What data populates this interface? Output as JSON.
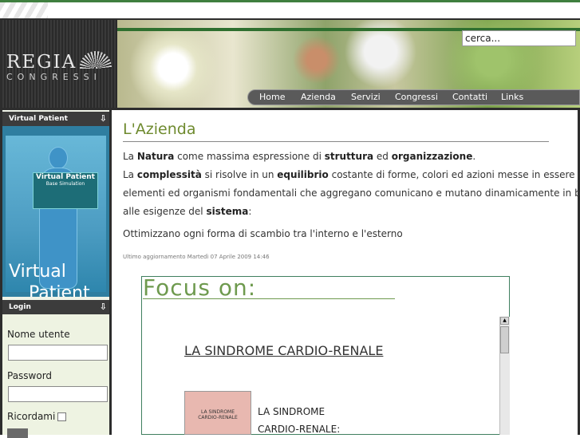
{
  "brand": {
    "name": "REGIA",
    "subtitle": "CONGRESSI"
  },
  "search": {
    "value": "cerca..."
  },
  "nav": {
    "items": [
      "Home",
      "Azienda",
      "Servizi",
      "Congressi",
      "Contatti",
      "Links"
    ]
  },
  "sidebar": {
    "virtual_patient": {
      "header": "Virtual Patient",
      "card_title": "Virtual Patient",
      "card_subtitle": "Base Simulation",
      "line1": "Virtual",
      "line2": "Patient"
    },
    "login": {
      "header": "Login",
      "username_label": "Nome utente",
      "password_label": "Password",
      "remember_label": "Ricordami"
    }
  },
  "main": {
    "title": "L'Azienda",
    "updated": "Ultimo aggiornamento Martedì 07 Aprile 2009 14:46",
    "focus": {
      "title": "Focus on:",
      "link": "LA SINDROME CARDIO-RENALE",
      "thumb_text": "LA SINDROME CARDIO-RENALE",
      "text_line1": "LA SINDROME",
      "text_line2": "CARDIO-RENALE:"
    }
  },
  "colors": {
    "accent": "#6e8a2e",
    "bar": "#3f7f3f",
    "nav_bg": "#5a5a5a"
  }
}
